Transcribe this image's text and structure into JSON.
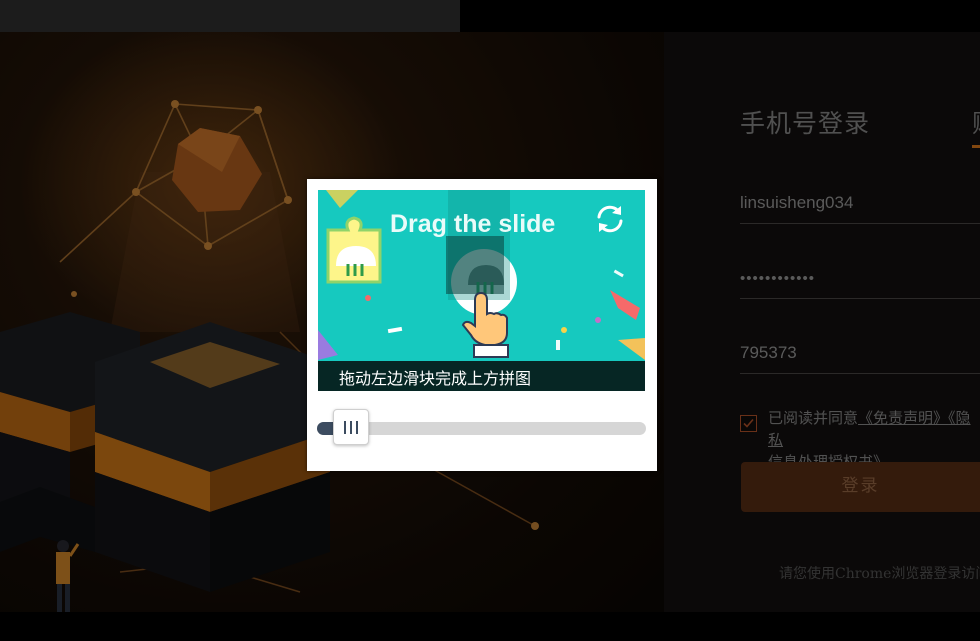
{
  "login": {
    "tabs": [
      {
        "label": "手机号登录"
      },
      {
        "label": "账"
      }
    ],
    "username": {
      "value": "linsuisheng034"
    },
    "password": {
      "value": "••••••••••••"
    },
    "code": {
      "value": "795373"
    },
    "agreement": {
      "checked": true,
      "prefix": "已阅读并同意",
      "link1": "《免责声明》",
      "link2": "《隐私",
      "link3": "信息处理授权书》"
    },
    "submit_label": "登录",
    "hint": "请您使用Chrome浏览器登录访问"
  },
  "captcha": {
    "image_title": "Drag the slide",
    "instruction": "拖动左边滑块完成上方拼图",
    "slider_progress": 0.0
  },
  "colors": {
    "accent": "#e07b1a",
    "login_button": "#5a2f16",
    "captcha_bg": "#16c9bf",
    "slider_fill": "#3c4c60"
  }
}
